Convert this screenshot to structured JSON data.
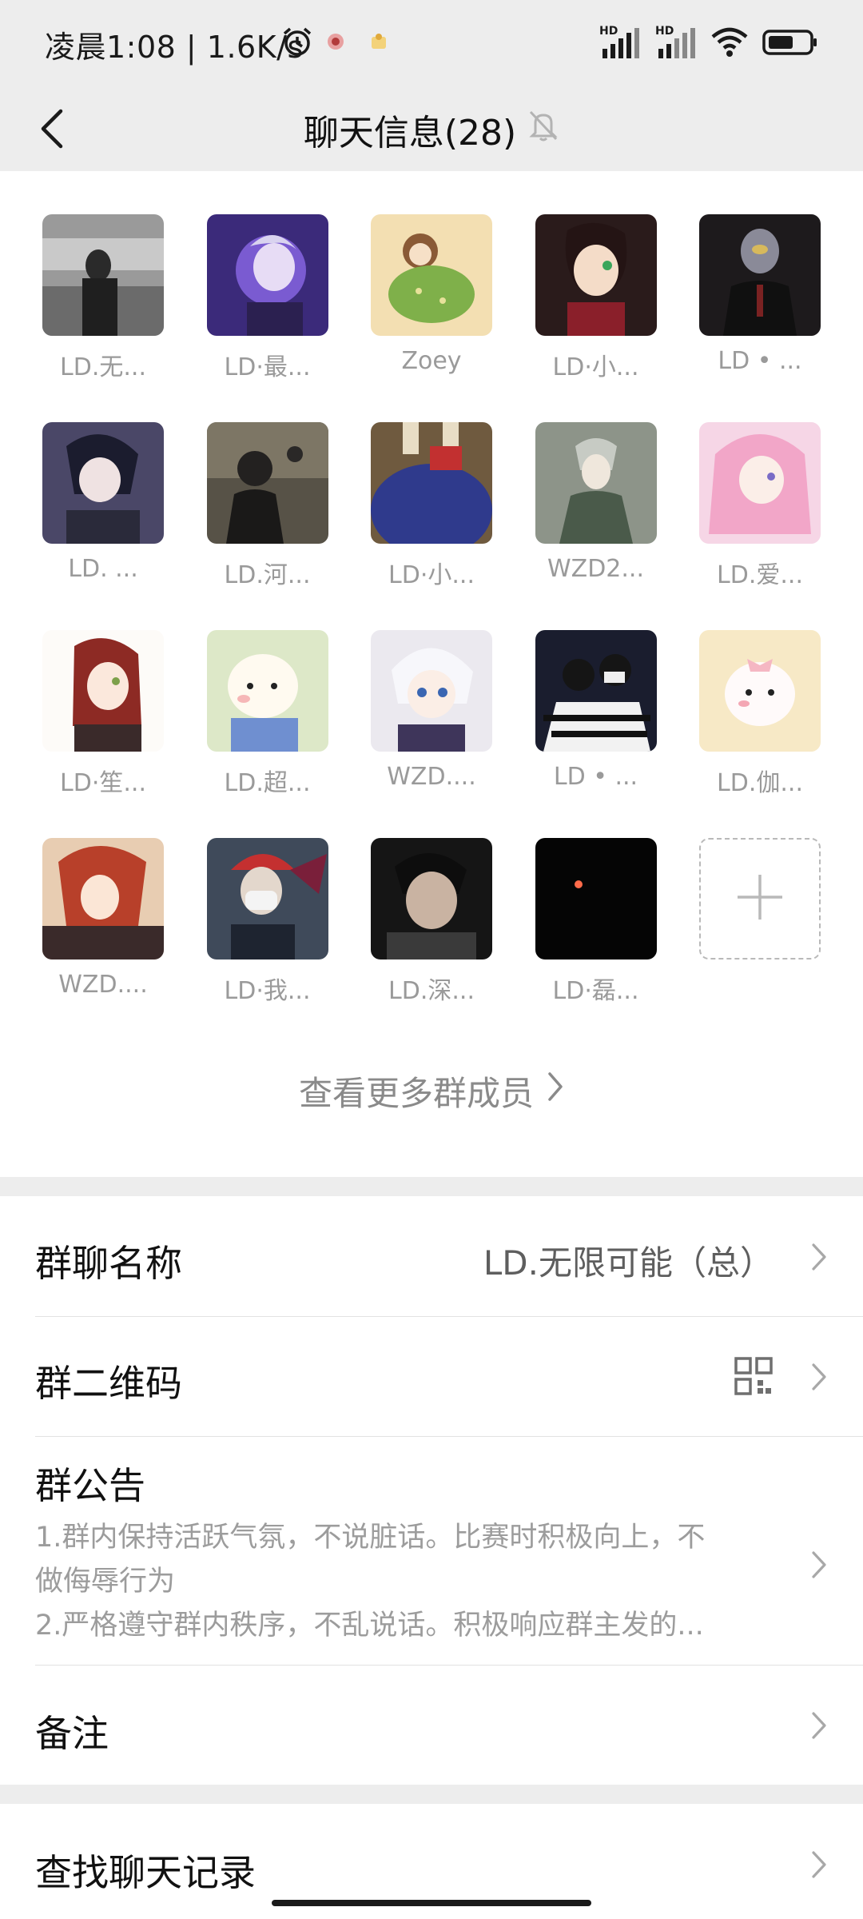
{
  "status_bar": {
    "time": "凌晨1:08 | 1.6K/s",
    "icons": [
      "alarm-icon",
      "app-notification-icon",
      "app-notification-icon",
      "hd-signal-icon",
      "hd-signal-icon",
      "wifi-icon",
      "battery-icon"
    ],
    "signal_label_1": "HD",
    "signal_label_2": "HD"
  },
  "header": {
    "title": "聊天信息(28)",
    "back_icon": "chevron-left-icon",
    "mute_icon": "bell-off-icon"
  },
  "members": [
    {
      "name": "LD.无..."
    },
    {
      "name": "LD·最..."
    },
    {
      "name": "Zoey"
    },
    {
      "name": "LD·小..."
    },
    {
      "name": "LD • ..."
    },
    {
      "name": "LD. ..."
    },
    {
      "name": "LD.河..."
    },
    {
      "name": "LD·小..."
    },
    {
      "name": "WZD2..."
    },
    {
      "name": "LD.爱..."
    },
    {
      "name": "LD·笙..."
    },
    {
      "name": "LD.超..."
    },
    {
      "name": "WZD...."
    },
    {
      "name": "LD • ..."
    },
    {
      "name": "LD.伽..."
    },
    {
      "name": "WZD...."
    },
    {
      "name": "LD·我..."
    },
    {
      "name": "LD.深..."
    },
    {
      "name": "LD·磊..."
    }
  ],
  "add_member_icon": "plus-icon",
  "view_more": "查看更多群成员",
  "settings": {
    "group_name": {
      "label": "群聊名称",
      "value": "LD.无限可能（总）"
    },
    "qr_code": {
      "label": "群二维码",
      "icon": "qr-code-icon"
    },
    "notice": {
      "label": "群公告",
      "lines": [
        "1.群内保持活跃气氛，不说脏话。比赛时积极向上，不",
        "做侮辱行为",
        "2.严格遵守群内秩序，不乱说话。积极响应群主发的..."
      ]
    },
    "remark": {
      "label": "备注"
    },
    "search_history": {
      "label": "查找聊天记录"
    }
  },
  "colors": {
    "page_background": "#ededed",
    "panel_background": "#ffffff",
    "secondary_text": "#9a9a9a"
  }
}
